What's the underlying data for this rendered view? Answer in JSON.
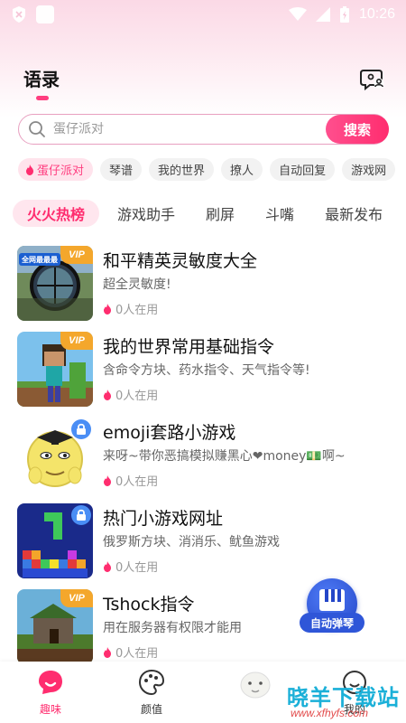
{
  "status_bar": {
    "time": "10:26"
  },
  "header": {
    "title": "语录"
  },
  "search": {
    "placeholder": "蛋仔派对",
    "button_label": "搜索"
  },
  "tags": [
    "蛋仔派对",
    "琴谱",
    "我的世界",
    "撩人",
    "自动回复",
    "游戏网"
  ],
  "categories": [
    "火火热榜",
    "游戏助手",
    "刷屏",
    "斗嘴",
    "最新发布"
  ],
  "items": [
    {
      "title": "和平精英灵敏度大全",
      "desc": "超全灵敏度!",
      "users": "0人在用",
      "badge": "VIP",
      "thumb_text": "全网最最最"
    },
    {
      "title": "我的世界常用基础指令",
      "desc": "含命令方块、药水指令、天气指令等!",
      "users": "0人在用",
      "badge": "VIP"
    },
    {
      "title": "emoji套路小游戏",
      "desc": "来呀~带你恶搞模拟赚黑心❤money💵啊~",
      "users": "0人在用",
      "badge": "lock"
    },
    {
      "title": "热门小游戏网址",
      "desc": "俄罗斯方块、消消乐、鱿鱼游戏",
      "users": "0人在用",
      "badge": "lock"
    },
    {
      "title": "Tshock指令",
      "desc": "用在服务器有权限才能用",
      "users": "0人在用",
      "badge": "VIP"
    }
  ],
  "floating_button": {
    "label": "自动弹琴"
  },
  "bottom_nav": [
    {
      "label": "趣味",
      "icon": "chat-icon",
      "active": true
    },
    {
      "label": "颜值",
      "icon": "palette-icon",
      "active": false
    },
    {
      "label": "",
      "icon": "sheep-icon",
      "active": false
    },
    {
      "label": "我的",
      "icon": "profile-icon",
      "active": false
    }
  ],
  "watermark": {
    "title": "晓羊下载站",
    "url": "www.xfhyfs.com"
  },
  "colors": {
    "accent": "#ff2d6f",
    "tag_bg": "#f2f2f2",
    "piano_blue": "#2f56d8",
    "vip_orange": "#f4a72c"
  }
}
